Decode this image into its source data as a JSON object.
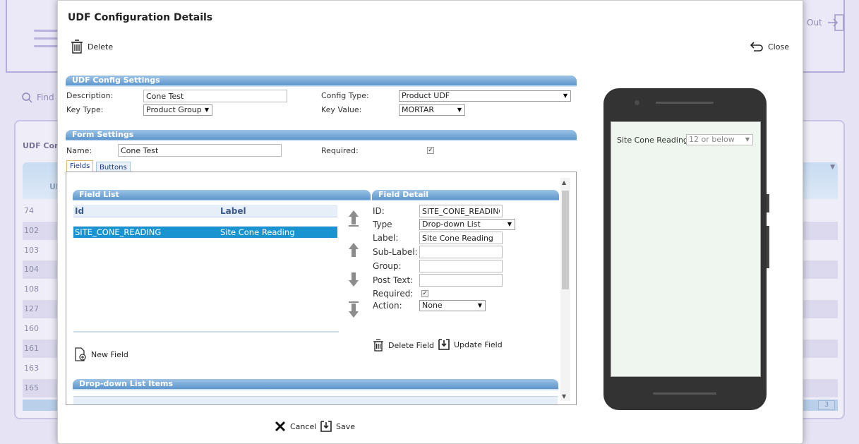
{
  "background": {
    "logout_label": "Out",
    "find_label": "Find",
    "panel_title": "UDF Conf",
    "grid_header_fragment": "UI",
    "rows": [
      "74",
      "102",
      "103",
      "104",
      "108",
      "127",
      "160",
      "161",
      "163",
      "165"
    ],
    "page_number": "3"
  },
  "modal": {
    "title": "UDF Configuration Details",
    "delete_label": "Delete",
    "close_label": "Close",
    "udf_settings": {
      "header": "UDF Config Settings",
      "description_label": "Description:",
      "description_value": "Cone Test",
      "key_type_label": "Key Type:",
      "key_type_value": "Product Group",
      "config_type_label": "Config Type:",
      "config_type_value": "Product UDF",
      "key_value_label": "Key Value:",
      "key_value_value": "MORTAR"
    },
    "form_settings": {
      "header": "Form Settings",
      "name_label": "Name:",
      "name_value": "Cone Test",
      "required_label": "Required:",
      "required_checked": true
    },
    "tabs": [
      {
        "label": "Fields",
        "active": true
      },
      {
        "label": "Buttons",
        "active": false
      }
    ],
    "field_list": {
      "header": "Field List",
      "columns": [
        "Id",
        "Label"
      ],
      "rows": [
        {
          "id": "SITE_CONE_READING",
          "label": "Site Cone Reading",
          "selected": true
        }
      ],
      "new_field_label": "New Field"
    },
    "field_detail": {
      "header": "Field Detail",
      "id_label": "ID:",
      "id_value": "SITE_CONE_READING",
      "type_label": "Type",
      "type_value": "Drop-down List",
      "label_label": "Label:",
      "label_value": "Site Cone Reading",
      "sublabel_label": "Sub-Label:",
      "sublabel_value": "",
      "group_label": "Group:",
      "group_value": "",
      "posttext_label": "Post Text:",
      "posttext_value": "",
      "required_label": "Required:",
      "required_checked": true,
      "action_label": "Action:",
      "action_value": "None",
      "delete_field_label": "Delete Field",
      "update_field_label": "Update Field"
    },
    "dropdown_items": {
      "header": "Drop-down List Items"
    },
    "footer": {
      "cancel_label": "Cancel",
      "save_label": "Save"
    },
    "preview": {
      "field_label": "Site Cone Reading:",
      "field_value": "12 or below"
    }
  },
  "colors": {
    "section_bar": "#5d96cc",
    "selected_row": "#1a94d0",
    "phone_body": "#333333",
    "phone_screen": "#eef6ef"
  }
}
